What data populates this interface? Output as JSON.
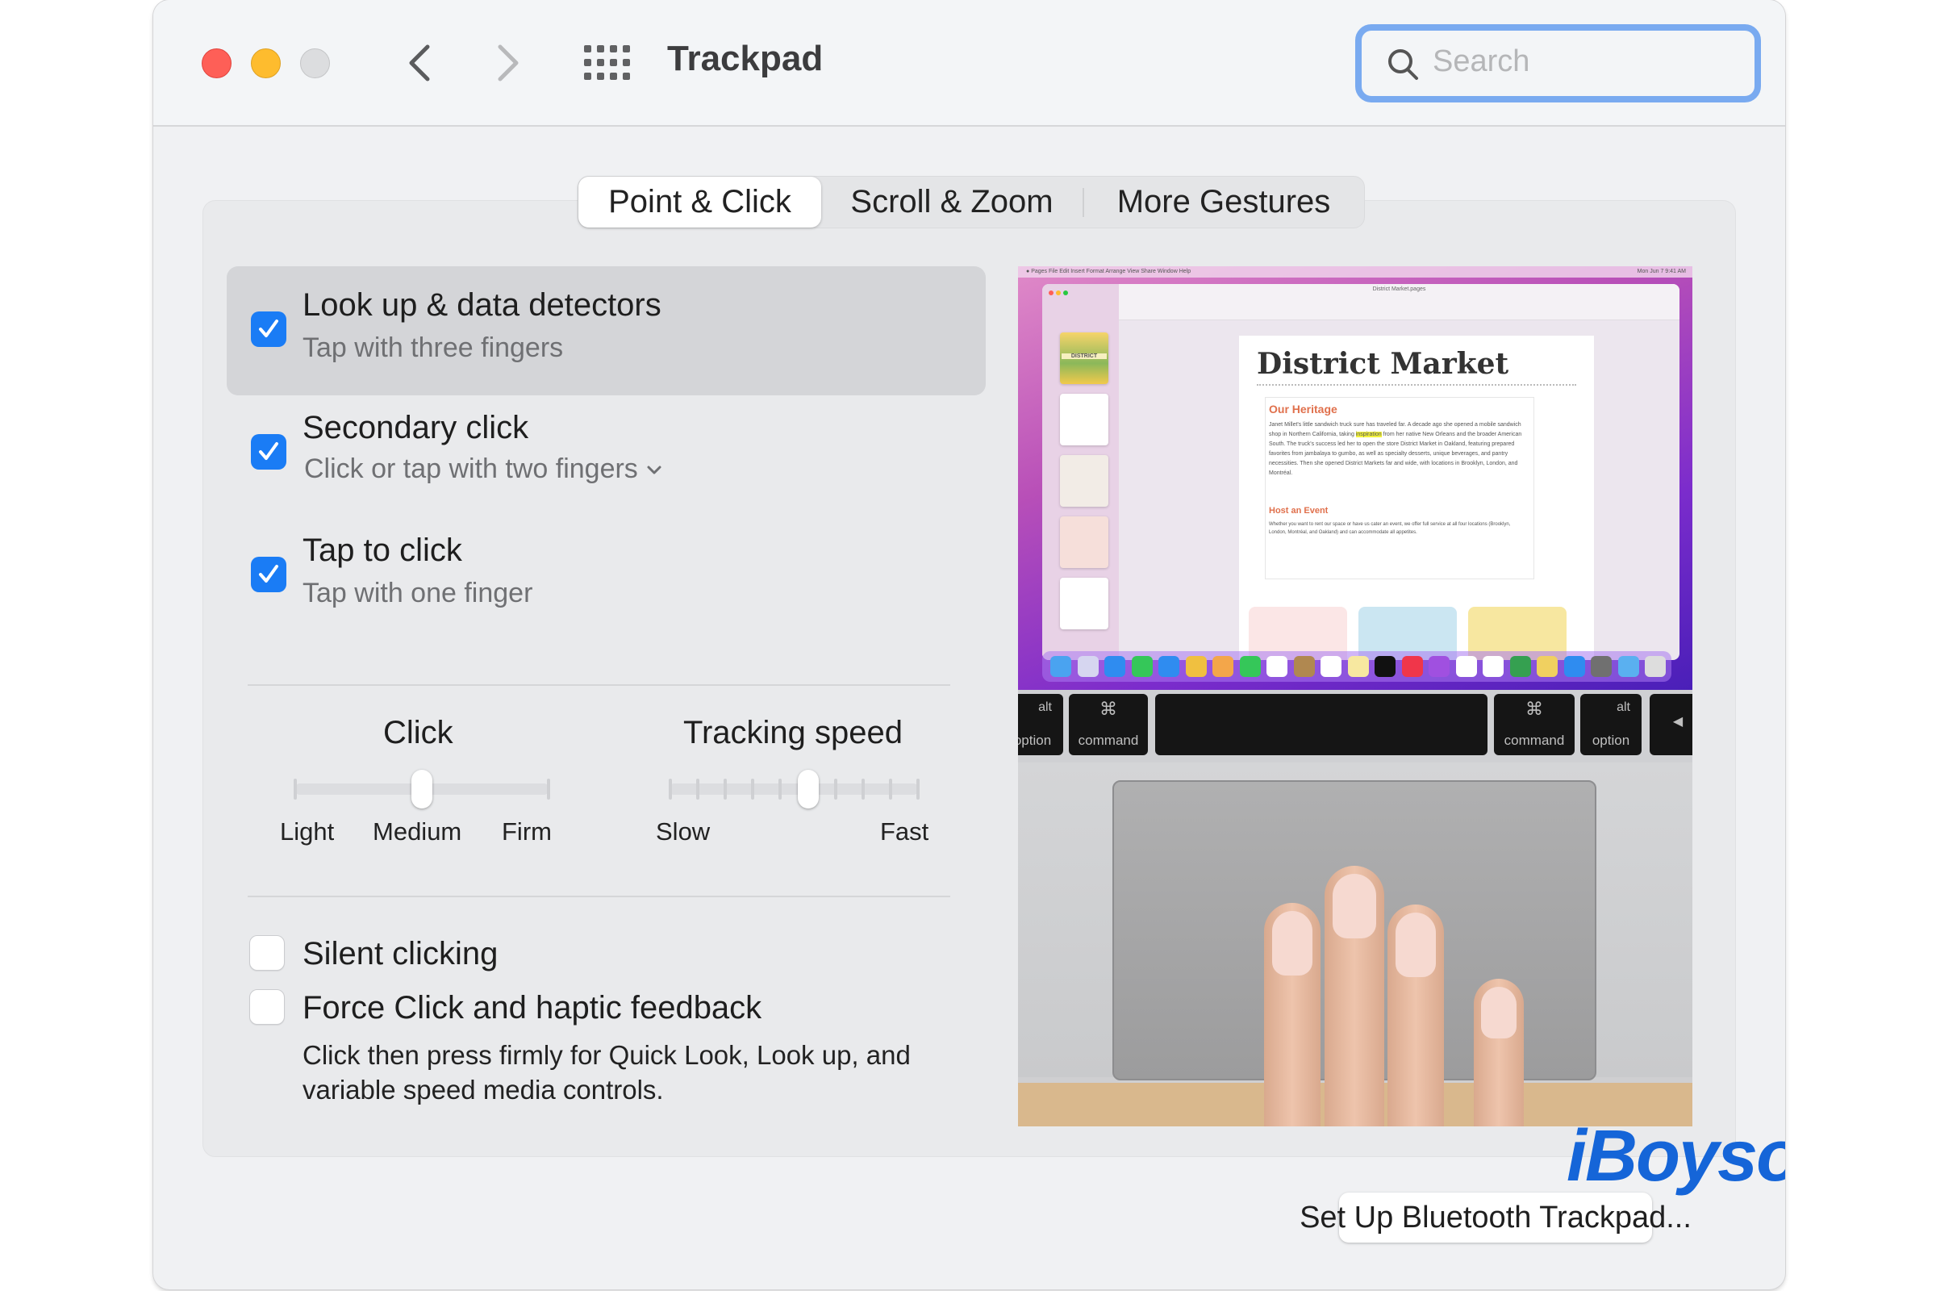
{
  "window": {
    "title": "Trackpad",
    "traffic_lights": {
      "close": "#fe5f57",
      "minimize": "#febc2e",
      "zoom": "#dcdddf"
    },
    "nav": {
      "back_icon": "chevron-left-icon",
      "forward_icon": "chevron-right-icon",
      "grid_icon": "show-all-grid-icon"
    },
    "search": {
      "placeholder": "Search",
      "value": "",
      "icon": "search-icon",
      "focus_ring_color": "#79aaf0"
    }
  },
  "tabs": [
    {
      "label": "Point & Click",
      "selected": true
    },
    {
      "label": "Scroll & Zoom",
      "selected": false
    },
    {
      "label": "More Gestures",
      "selected": false
    }
  ],
  "options": [
    {
      "label": "Look up & data detectors",
      "sublabel": "Tap with three fingers",
      "checked": true,
      "highlighted": true,
      "has_dropdown": false
    },
    {
      "label": "Secondary click",
      "sublabel": "Click or tap with two fingers",
      "checked": true,
      "highlighted": false,
      "has_dropdown": true
    },
    {
      "label": "Tap to click",
      "sublabel": "Tap with one finger",
      "checked": true,
      "highlighted": false,
      "has_dropdown": false
    }
  ],
  "sliders": {
    "click": {
      "title": "Click",
      "labels": [
        "Light",
        "Medium",
        "Firm"
      ],
      "stops": 3,
      "value_index": 1,
      "value_label": "Medium"
    },
    "tracking": {
      "title": "Tracking speed",
      "min_label": "Slow",
      "max_label": "Fast",
      "stops": 10,
      "value_index": 5
    }
  },
  "bottom_options": [
    {
      "label": "Silent clicking",
      "checked": false
    },
    {
      "label": "Force Click and haptic feedback",
      "checked": false,
      "description": "Click then press firmly for Quick Look, Look up, and variable speed media controls."
    }
  ],
  "preview": {
    "menubar_items": [
      "Pages",
      "File",
      "Edit",
      "Insert",
      "Format",
      "Arrange",
      "View",
      "Share",
      "Window",
      "Help"
    ],
    "menubar_clock": "Mon Jun 7  9:41 AM",
    "document_name": "District Market.pages",
    "doc_title": "District Market",
    "section1_heading": "Our Heritage",
    "section1_text_before": "Janet Millet's little sandwich truck sure has traveled far. A decade ago she opened a mobile sandwich shop in Northern California, taking ",
    "section1_highlight": "inspiration",
    "section1_text_after": " from her native New Orleans and the broader American South. The truck's success led her to open the store District Market in Oakland, featuring prepared favorites from jambalaya to gumbo, as well as specialty desserts, unique beverages, and pantry necessities. Then she opened District Markets far and wide, with locations in Brooklyn, London, and Montréal.",
    "section2_heading": "Host an Event",
    "section2_text": "Whether you want to rent our space or have us cater an event, we offer full service at all four locations (Brooklyn, London, Montréal, and Oakland) and can accommodate all appetites.",
    "thumb_label": "DISTRICT",
    "keys": {
      "left_option_top": "alt",
      "left_option_bottom": "option",
      "left_command_symbol": "⌘",
      "left_command_label": "command",
      "right_command_symbol": "⌘",
      "right_command_label": "command",
      "right_option_top": "alt",
      "right_option_bottom": "option",
      "arrow": "◀"
    }
  },
  "watermark": "iBoysoft",
  "buttons": {
    "setup_bluetooth": "Set Up Bluetooth Trackpad...",
    "help": "?"
  }
}
